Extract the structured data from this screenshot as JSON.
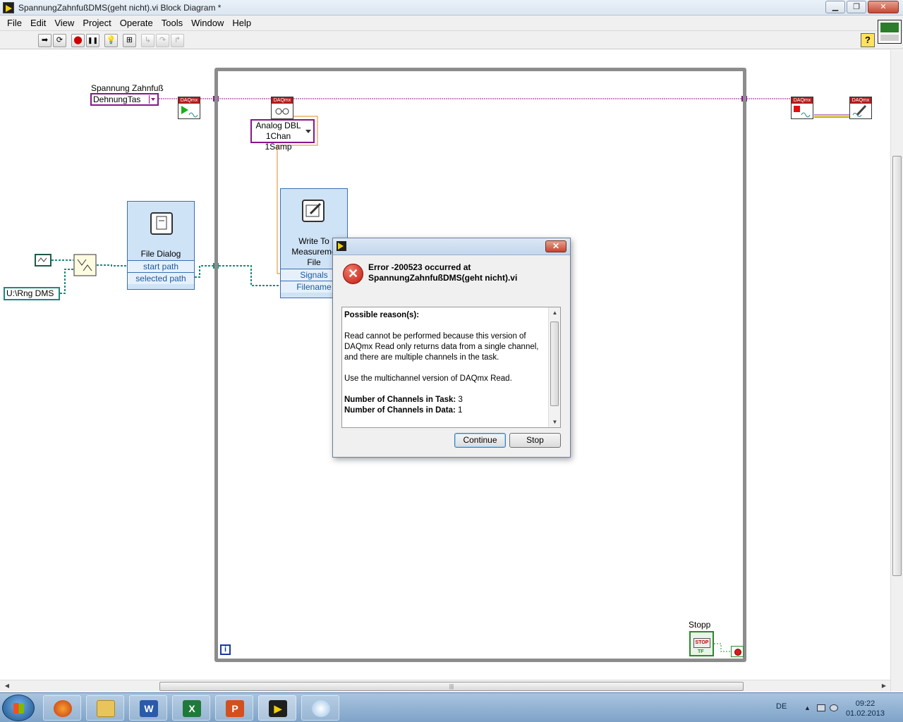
{
  "window": {
    "title": "SpannungZahnfußDMS(geht nicht).vi Block Diagram *",
    "buttons": {
      "minimize": "▁",
      "maximize": "❐",
      "close": "✕"
    }
  },
  "menu": [
    "File",
    "Edit",
    "View",
    "Project",
    "Operate",
    "Tools",
    "Window",
    "Help"
  ],
  "toolbar": {
    "run": "➡",
    "run_continuously": "⟳",
    "abort": "⬤",
    "pause": "❚❚",
    "highlight": "💡",
    "retain": "⊞",
    "step_into": "↳",
    "step_over": "↷",
    "step_out": "↱",
    "help": "?"
  },
  "diagram": {
    "ring_label": "Spannung Zahnfuß",
    "ring_value": "DehnungTas",
    "poly_selector": {
      "line1": "Analog DBL",
      "line2": "1Chan 1Samp"
    },
    "daqmx_tag": "DAQmx",
    "file_dialog": {
      "title": "File Dialog",
      "in_terminal": "start path",
      "out_terminal": "selected path"
    },
    "write_file": {
      "title_line1": "Write To",
      "title_line2": "Measureme",
      "title_line3": "File",
      "terminal1": "Signals",
      "terminal2": "Filename"
    },
    "path_constant": "U:\\Rng DMS",
    "stop_label": "Stopp",
    "stop_button_text": "STOP",
    "stop_tf": "TF",
    "iteration": "i"
  },
  "error_dialog": {
    "heading_line1": "Error -200523 occurred at",
    "heading_line2": "SpannungZahnfußDMS(geht nicht).vi",
    "possible_reasons": "Possible reason(s):",
    "message1": "Read cannot be performed because this version of DAQmx Read only returns data from a single channel, and there are multiple channels in the task.",
    "message2": "Use the multichannel version of DAQmx Read.",
    "channels_task_label": "Number of Channels in Task:",
    "channels_task_value": "3",
    "channels_data_label": "Number of Channels in Data:",
    "channels_data_value": "1",
    "continue_button": "Continue",
    "stop_button": "Stop",
    "close_glyph": "✕"
  },
  "scrollbar": {
    "grip": "|||"
  },
  "taskbar": {
    "apps": [
      "firefox",
      "explorer",
      "word",
      "excel",
      "powerpoint",
      "labview",
      "paint"
    ],
    "language": "DE",
    "time": "09:22",
    "date": "01.02.2013"
  },
  "colors": {
    "error_red": "#c01b10",
    "wire_purple": "#8a158c",
    "wire_teal": "#1d8a7a",
    "loop_gray": "#8c8c8c"
  }
}
